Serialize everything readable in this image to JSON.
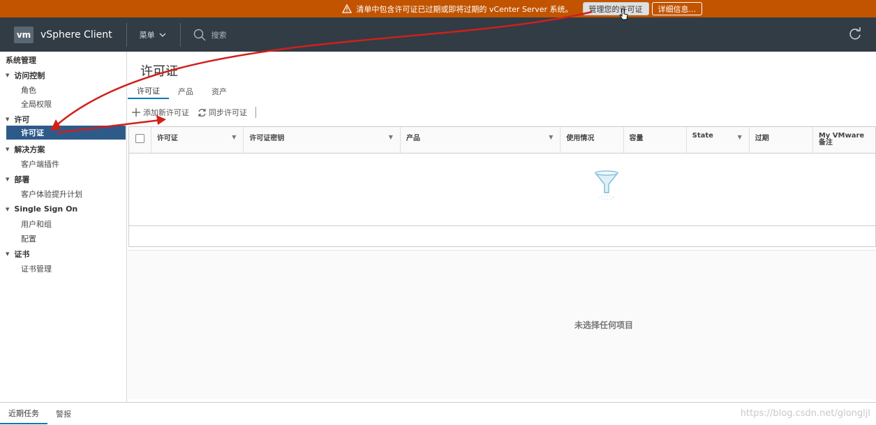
{
  "banner": {
    "message": "清单中包含许可证已过期或即将过期的 vCenter Server 系统。",
    "manage_button": "管理您的许可证",
    "details_button": "详细信息..."
  },
  "header": {
    "logo": "vm",
    "app_name": "vSphere Client",
    "menu_label": "菜单",
    "search_placeholder": "搜索"
  },
  "sidebar": {
    "title": "系统管理",
    "groups": [
      {
        "label": "访问控制",
        "items": [
          "角色",
          "全局权限"
        ]
      },
      {
        "label": "许可",
        "items": [
          "许可证"
        ]
      },
      {
        "label": "解决方案",
        "items": [
          "客户端插件"
        ]
      },
      {
        "label": "部署",
        "items": [
          "客户体验提升计划"
        ]
      },
      {
        "label": "Single Sign On",
        "items": [
          "用户和组",
          "配置"
        ]
      },
      {
        "label": "证书",
        "items": [
          "证书管理"
        ]
      }
    ]
  },
  "main": {
    "title": "许可证",
    "tabs": [
      "许可证",
      "产品",
      "资产"
    ],
    "actions": {
      "add": "添加新许可证",
      "sync": "同步许可证"
    },
    "columns": [
      "许可证",
      "许可证密钥",
      "产品",
      "使用情况",
      "容量",
      "State",
      "过期",
      "My VMware 备注"
    ],
    "no_selection": "未选择任何项目"
  },
  "bottom_tabs": [
    "近期任务",
    "警报"
  ],
  "watermark": "https://blog.csdn.net/glongljl",
  "colors": {
    "banner": "#c25400",
    "header": "#313c45",
    "selected": "#2e5a8a",
    "accent": "#0079b8",
    "annotation_arrow": "#d0201a"
  }
}
